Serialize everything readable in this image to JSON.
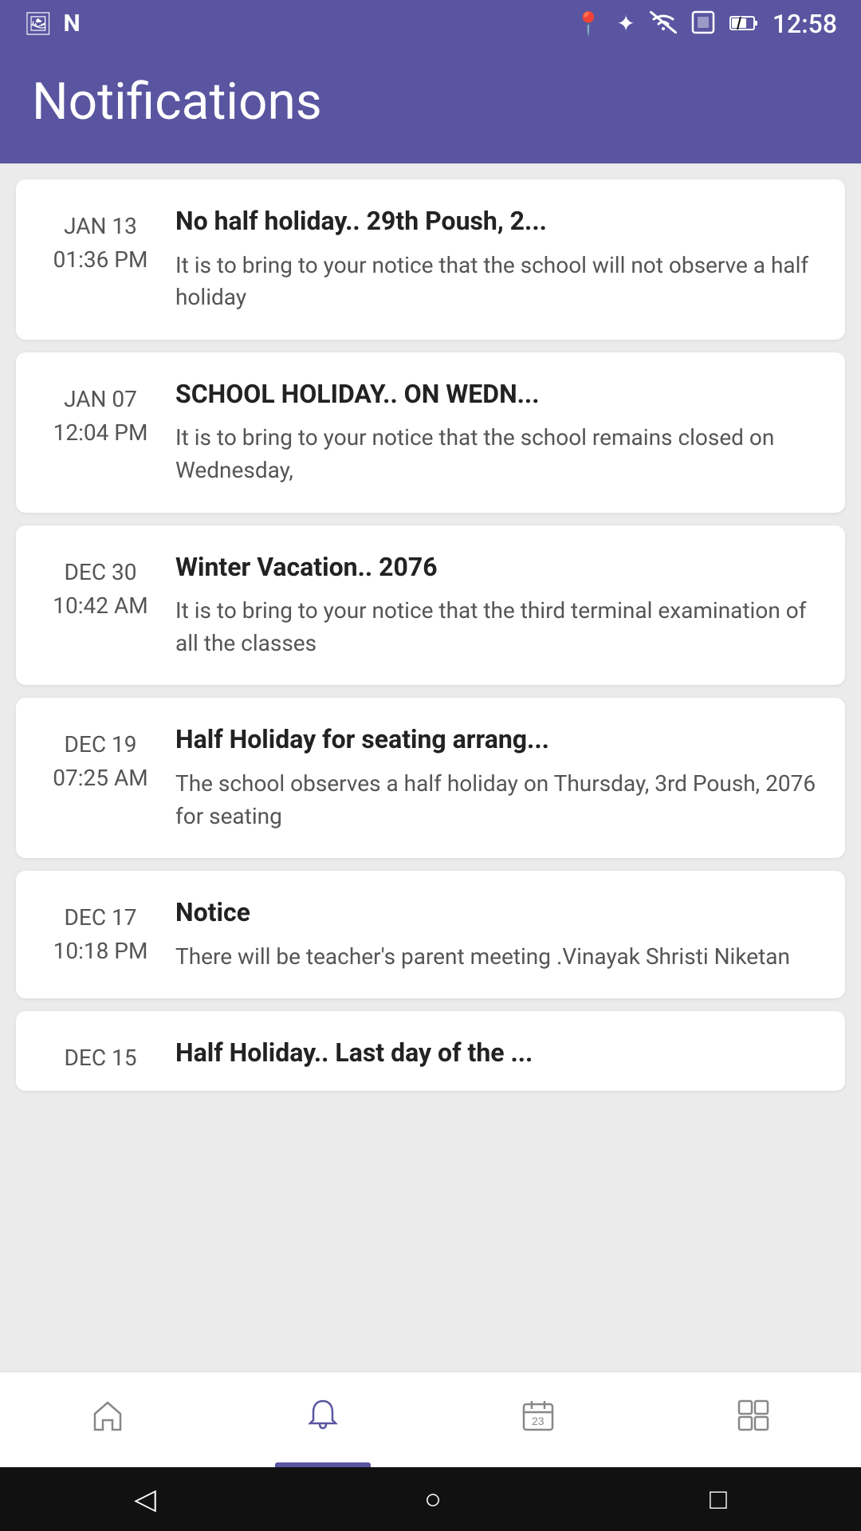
{
  "statusBar": {
    "time": "12:58",
    "icons": [
      "photo",
      "N",
      "location",
      "bluetooth",
      "wifi",
      "sim",
      "battery"
    ]
  },
  "header": {
    "title": "Notifications"
  },
  "notifications": [
    {
      "date": "JAN 13",
      "time": "01:36 PM",
      "title": "No half holiday.. 29th Poush, 2...",
      "body": "It is to bring to your notice that the school will not observe a half holiday"
    },
    {
      "date": "JAN 07",
      "time": "12:04 PM",
      "title": "SCHOOL HOLIDAY.. ON WEDN...",
      "body": "It is to bring to your notice that the school remains closed on Wednesday,"
    },
    {
      "date": "DEC 30",
      "time": "10:42 AM",
      "title": "Winter Vacation.. 2076",
      "body": "It is to bring to your notice that the third terminal examination of all the classes"
    },
    {
      "date": "DEC 19",
      "time": "07:25 AM",
      "title": "Half Holiday for seating arrang...",
      "body": "The school observes a half holiday on Thursday, 3rd Poush, 2076 for seating"
    },
    {
      "date": "DEC 17",
      "time": "10:18 PM",
      "title": "Notice",
      "body": "There will be teacher's  parent meeting .Vinayak Shristi Niketan"
    },
    {
      "date": "DEC 15",
      "time": "",
      "title": "Half Holiday.. Last day of the ...",
      "body": ""
    }
  ],
  "bottomNav": [
    {
      "icon": "home",
      "label": "Home",
      "active": false
    },
    {
      "icon": "bell",
      "label": "Notifications",
      "active": true
    },
    {
      "icon": "calendar",
      "label": "Calendar",
      "active": false
    },
    {
      "icon": "grid",
      "label": "Menu",
      "active": false
    }
  ],
  "systemNav": {
    "back": "◁",
    "home": "○",
    "recent": "□"
  }
}
